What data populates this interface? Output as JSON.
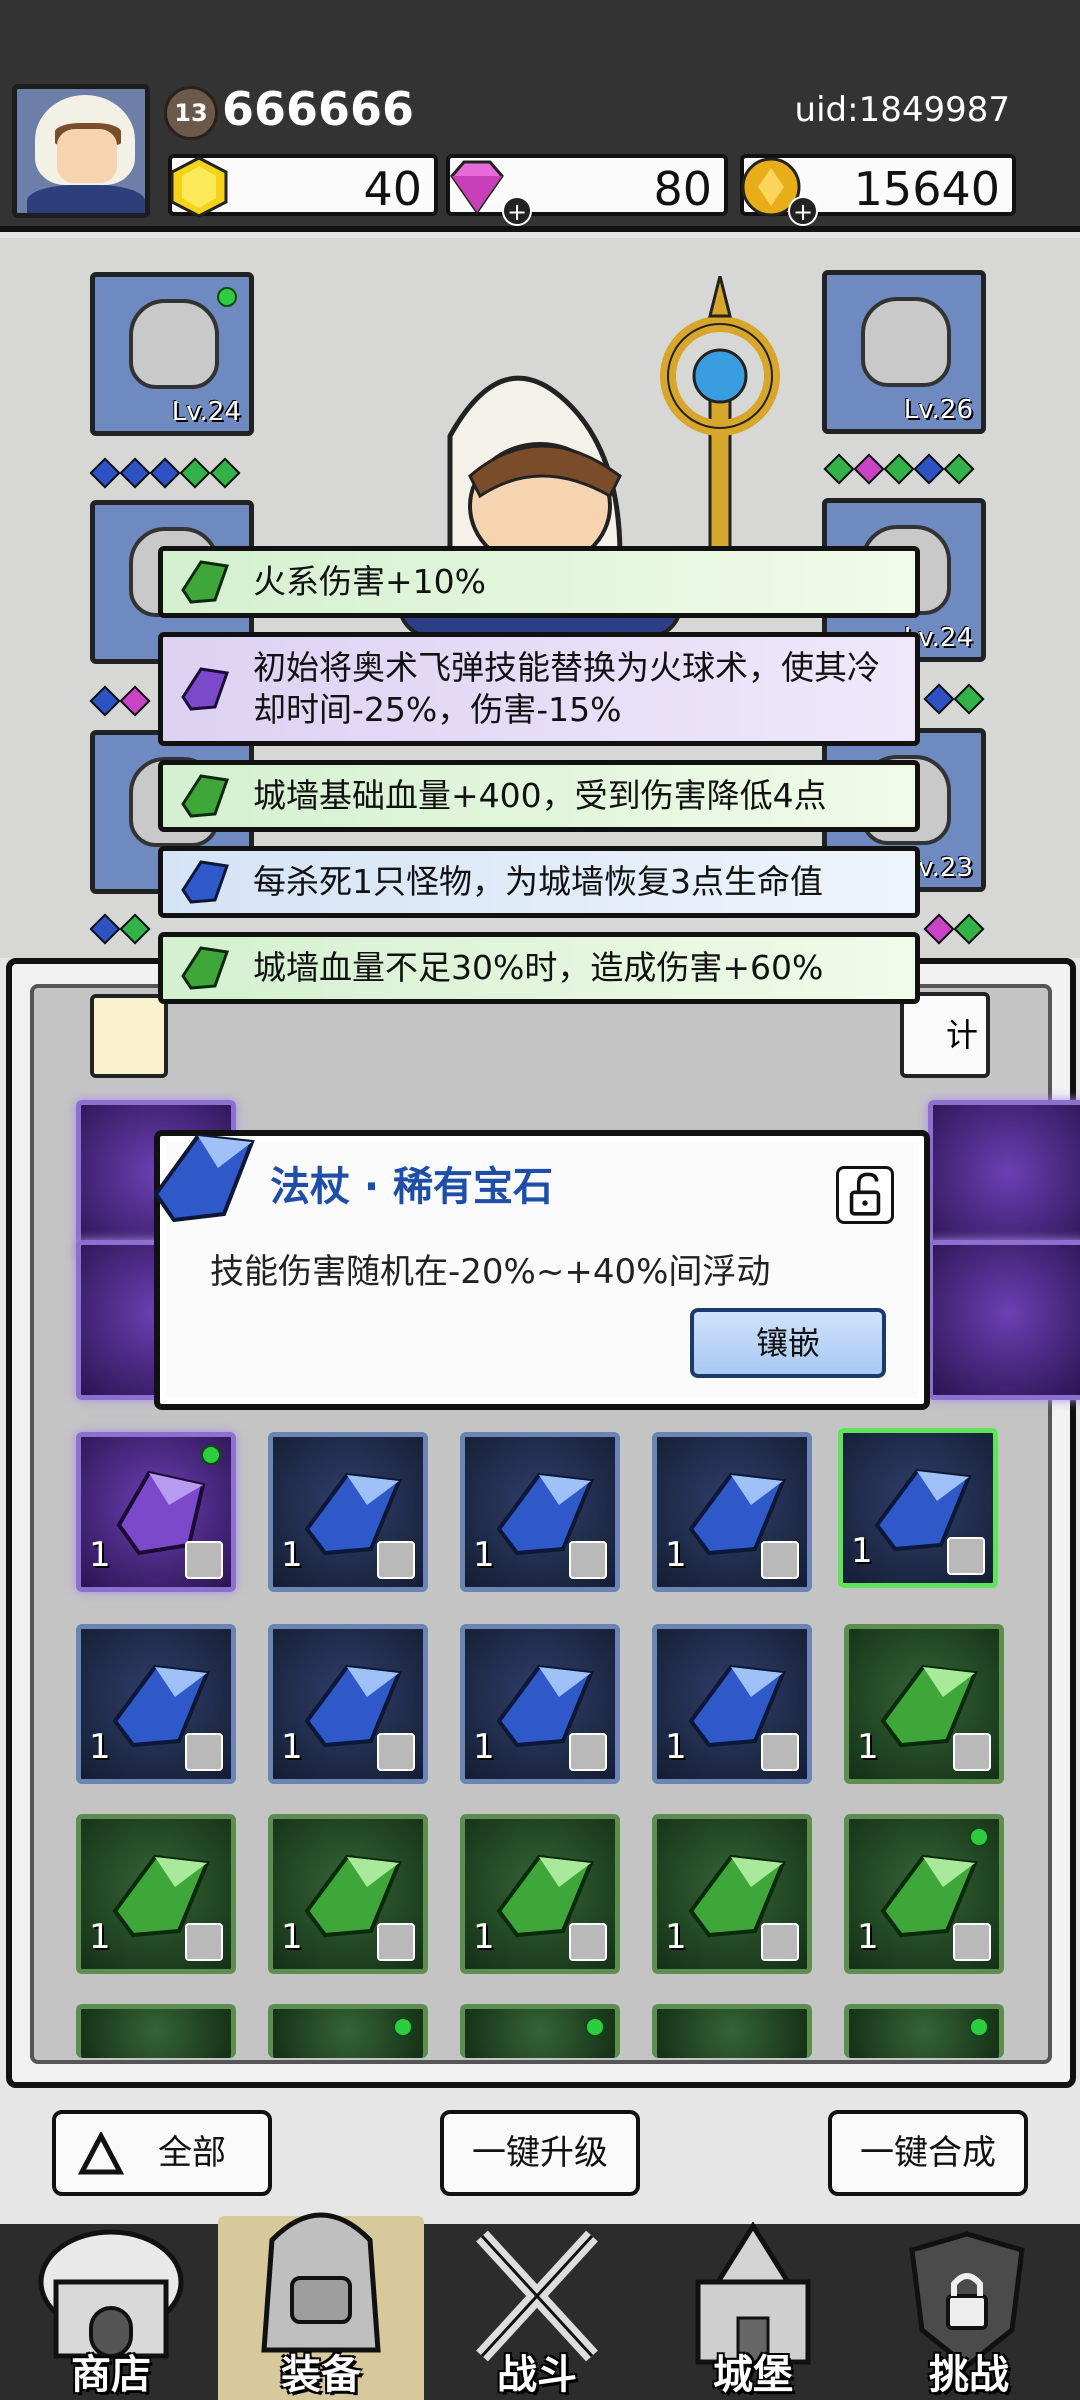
{
  "player": {
    "level": "13",
    "power": "666666",
    "uid": "uid:1849987"
  },
  "resources": {
    "gold_bar": "40",
    "diamond": "80",
    "coin": "15640"
  },
  "equipment": {
    "slots": [
      {
        "name": "helmet",
        "level": "Lv.24"
      },
      {
        "name": "gauntlet",
        "level": "Lv.26"
      },
      {
        "name": "armor",
        "level": ""
      },
      {
        "name": "ring",
        "level": "Lv.24"
      },
      {
        "name": "boots",
        "level": ""
      },
      {
        "name": "necklace",
        "level": "Lv.23"
      }
    ]
  },
  "effects": [
    {
      "color": "green",
      "text": "火系伤害+10%"
    },
    {
      "color": "purple",
      "text": "初始将奥术飞弹技能替换为火球术，使其冷却时间-25%，伤害-15%"
    },
    {
      "color": "green",
      "text": "城墙基础血量+400，受到伤害降低4点"
    },
    {
      "color": "blue",
      "text": "每杀死1只怪物，为城墙恢复3点生命值"
    },
    {
      "color": "green",
      "text": "城墙血量不足30%时，造成伤害+60%"
    }
  ],
  "gem_popup": {
    "title": "法杖 · 稀有宝石",
    "description": "技能伤害随机在-20%~+40%间浮动",
    "inlay_button": "镶嵌"
  },
  "panel": {
    "stat_tab_label": "计"
  },
  "grid": {
    "count_label": "1"
  },
  "actions": {
    "filter_all": "全部",
    "upgrade_all": "一键升级",
    "merge_all": "一键合成"
  },
  "nav": {
    "shop": "商店",
    "equipment": "装备",
    "battle": "战斗",
    "castle": "城堡",
    "challenge": "挑战"
  },
  "colors": {
    "purple_gem": "#7b49c9",
    "blue_gem": "#2f58c8",
    "green_gem": "#3fa63a",
    "accent_title": "#1e4ea8"
  }
}
